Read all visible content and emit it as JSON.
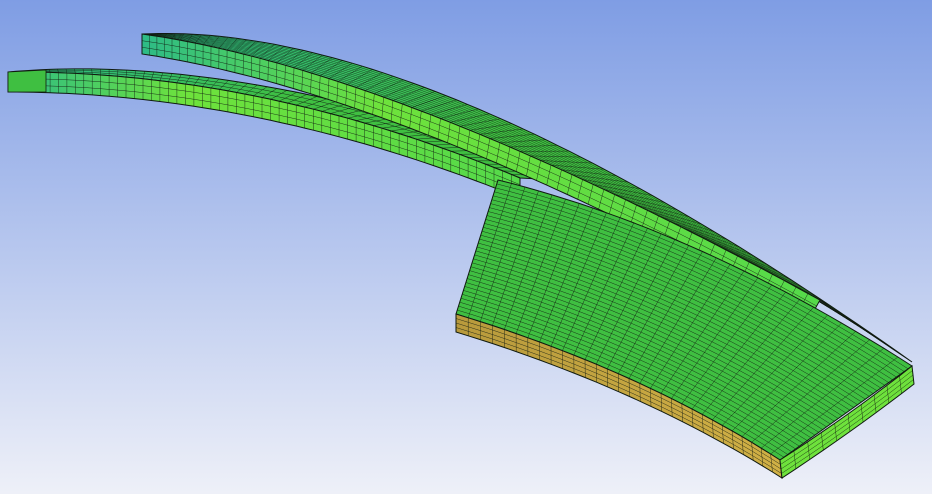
{
  "viewport": {
    "background_top": "#7f9de4",
    "background_bottom": "#eef0f8"
  },
  "mesh": {
    "top_face_color": "#3fbf41",
    "top_face_light": "#55d94a",
    "top_face_teal": "#2dbb86",
    "side_face_color": "#6ee23c",
    "end_face_color": "#b89a3c",
    "end_face_light": "#d0b045",
    "grid_line_color": "#101a10"
  }
}
